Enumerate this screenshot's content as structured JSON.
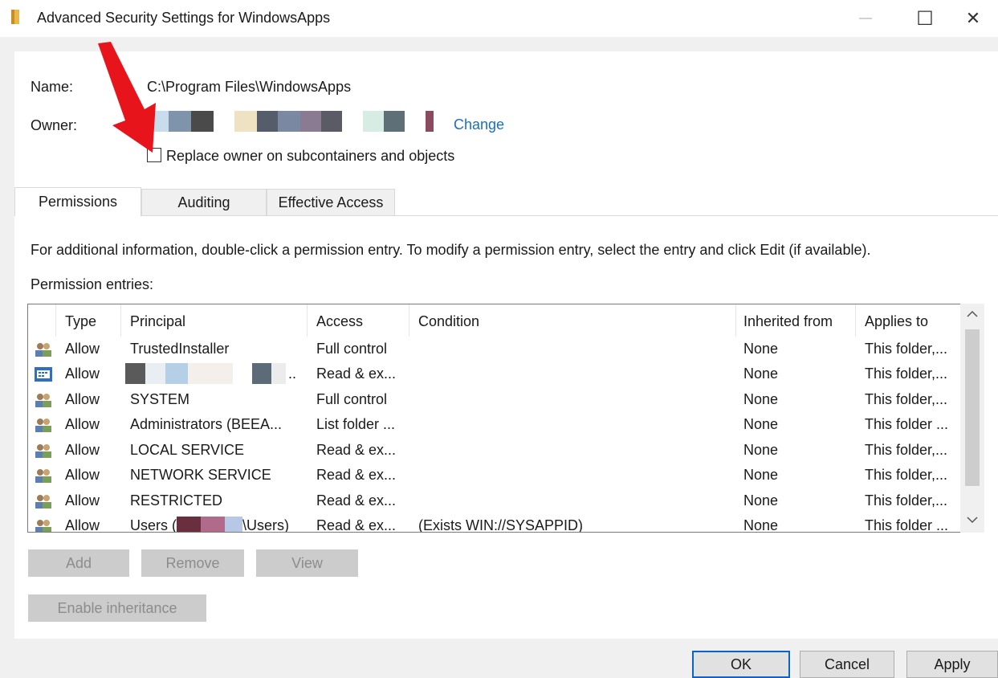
{
  "window": {
    "title": "Advanced Security Settings for WindowsApps",
    "minimize_glyph": "—",
    "maximize_glyph": "☐",
    "close_glyph": "✕"
  },
  "name_label": "Name:",
  "name_value": "C:\\Program Files\\WindowsApps",
  "owner_label": "Owner:",
  "owner_change_link": "Change",
  "replace_owner_checkbox": {
    "label": "Replace owner on subcontainers and objects",
    "checked": false
  },
  "tabs": [
    {
      "label": "Permissions",
      "active": true
    },
    {
      "label": "Auditing",
      "active": false
    },
    {
      "label": "Effective Access",
      "active": false
    }
  ],
  "info_text": "For additional information, double-click a permission entry. To modify a permission entry, select the entry and click Edit (if available).",
  "permission_entries_label": "Permission entries:",
  "columns": [
    "Type",
    "Principal",
    "Access",
    "Condition",
    "Inherited from",
    "Applies to"
  ],
  "rows": [
    {
      "icon": "users-icon",
      "type": "Allow",
      "principal": "TrustedInstaller",
      "access": "Full control",
      "condition": "",
      "inherited": "None",
      "applies": "This folder,..."
    },
    {
      "icon": "app-package-icon",
      "type": "Allow",
      "principal": "..",
      "access": "Read & ex...",
      "condition": "",
      "inherited": "None",
      "applies": "This folder,..."
    },
    {
      "icon": "users-icon",
      "type": "Allow",
      "principal": "SYSTEM",
      "access": "Full control",
      "condition": "",
      "inherited": "None",
      "applies": "This folder,..."
    },
    {
      "icon": "users-icon",
      "type": "Allow",
      "principal": "Administrators (BEEA...",
      "access": "List folder ...",
      "condition": "",
      "inherited": "None",
      "applies": "This folder ..."
    },
    {
      "icon": "users-icon",
      "type": "Allow",
      "principal": "LOCAL SERVICE",
      "access": "Read & ex...",
      "condition": "",
      "inherited": "None",
      "applies": "This folder,..."
    },
    {
      "icon": "users-icon",
      "type": "Allow",
      "principal": "NETWORK SERVICE",
      "access": "Read & ex...",
      "condition": "",
      "inherited": "None",
      "applies": "This folder,..."
    },
    {
      "icon": "users-icon",
      "type": "Allow",
      "principal": "RESTRICTED",
      "access": "Read & ex...",
      "condition": "",
      "inherited": "None",
      "applies": "This folder,..."
    },
    {
      "icon": "users-icon",
      "type": "Allow",
      "principal_prefix": "Users (",
      "principal_suffix": "\\Users)",
      "access": "Read & ex...",
      "condition": "(Exists WIN://SYSAPPID)",
      "inherited": "None",
      "applies": "This folder ..."
    }
  ],
  "buttons": {
    "add": "Add",
    "remove": "Remove",
    "view": "View",
    "enable_inheritance": "Enable inheritance",
    "ok": "OK",
    "cancel": "Cancel",
    "apply": "Apply"
  },
  "colors": {
    "link": "#1a6fc0",
    "annotation_arrow": "#e8141c",
    "disabled_button": "#cccccc",
    "default_button_border": "#0a64c8"
  }
}
